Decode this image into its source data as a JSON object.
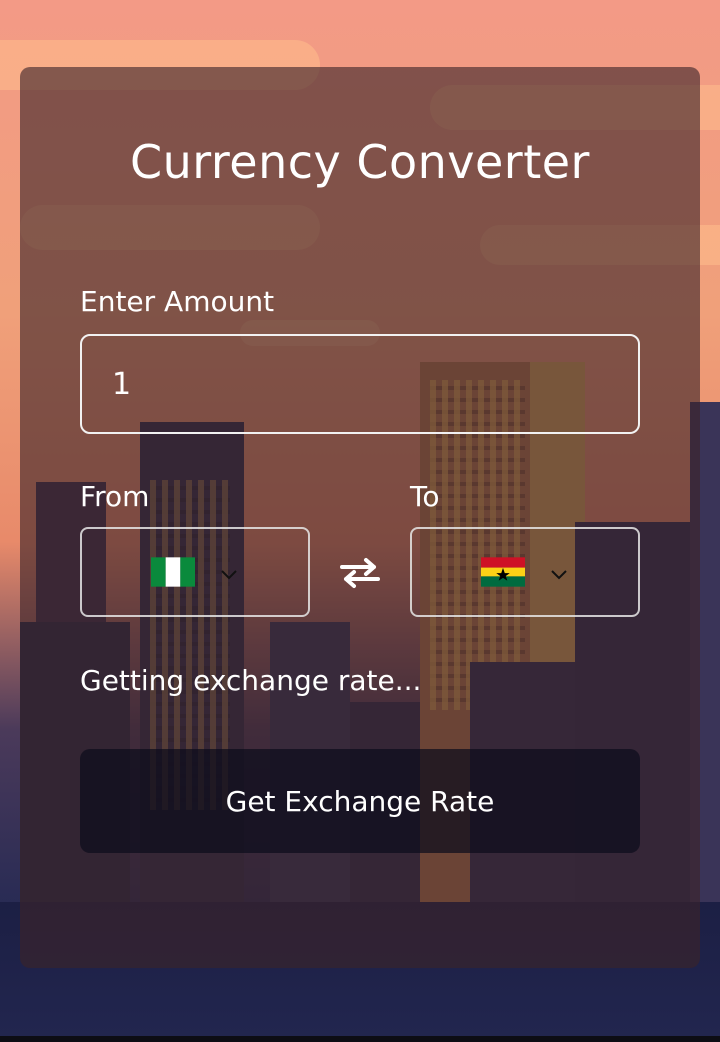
{
  "app": {
    "title": "Currency Converter"
  },
  "amount": {
    "label": "Enter Amount",
    "value": "1"
  },
  "from": {
    "label": "From",
    "flag_icon": "nigeria-flag-icon",
    "dropdown_icon": "chevron-down-icon"
  },
  "to": {
    "label": "To",
    "flag_icon": "ghana-flag-icon",
    "dropdown_icon": "chevron-down-icon"
  },
  "swap": {
    "icon": "swap-arrows-icon"
  },
  "status": {
    "text": "Getting exchange rate..."
  },
  "button": {
    "label": "Get Exchange Rate"
  },
  "colors": {
    "nigeria_green": "#0a8a3c",
    "ghana_red": "#ce1126",
    "ghana_gold": "#fcd116",
    "ghana_green": "#006b3f"
  }
}
